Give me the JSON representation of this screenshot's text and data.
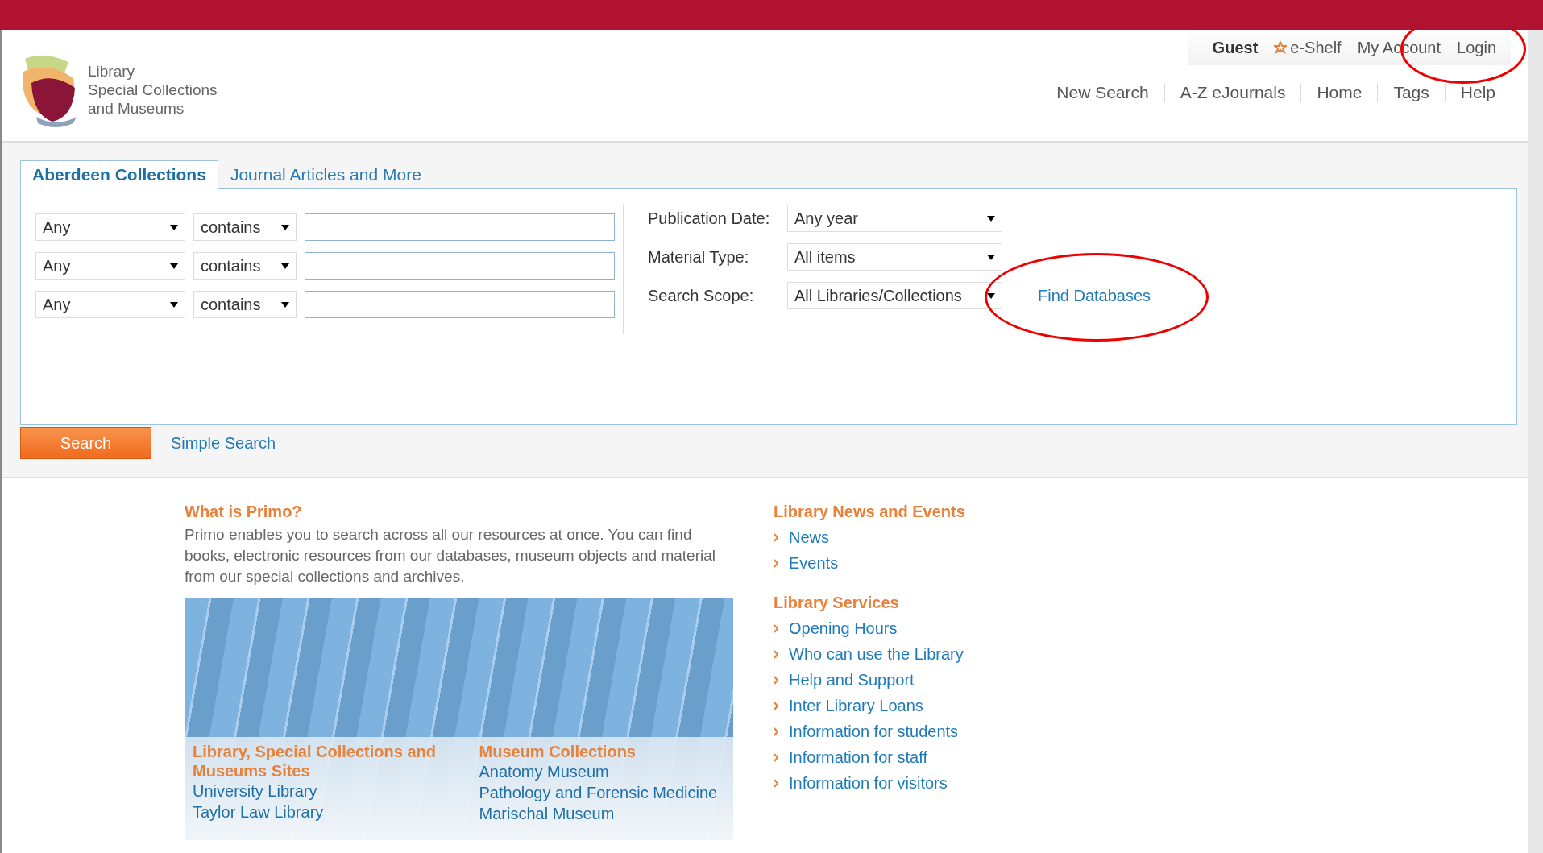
{
  "user_bar": {
    "user": "Guest",
    "links": [
      {
        "kind": "eshelf",
        "label": "e-Shelf"
      },
      {
        "kind": "plain",
        "label": "My Account"
      },
      {
        "kind": "plain",
        "label": "Login",
        "circled": true
      }
    ]
  },
  "logo": {
    "lines": [
      "Library",
      "Special Collections",
      "and Museums"
    ]
  },
  "nav": [
    "New Search",
    "A-Z eJournals",
    "Home",
    "Tags",
    "Help"
  ],
  "tabs": [
    {
      "label": "Aberdeen Collections",
      "selected": true
    },
    {
      "label": "Journal Articles and More",
      "selected": false
    }
  ],
  "query_rows": [
    {
      "field": "Any",
      "operator": "contains"
    },
    {
      "field": "Any",
      "operator": "contains"
    },
    {
      "field": "Any",
      "operator": "contains"
    }
  ],
  "filters": [
    {
      "label": "Publication Date:",
      "value": "Any year"
    },
    {
      "label": "Material Type:",
      "value": "All items"
    },
    {
      "label": "Search Scope:",
      "value": "All Libraries/Collections"
    }
  ],
  "find_databases": {
    "label": "Find Databases",
    "circled": true
  },
  "search_button": "Search",
  "simple_search": "Simple Search",
  "intro": {
    "title": "What is Primo?",
    "text": "Primo enables you to search across all our resources at once. You can find books, electronic resources from our databases, museum objects and material from our special collections and archives."
  },
  "photo_columns": [
    {
      "title": "Library, Special Collections and Museums Sites",
      "links": [
        "University Library",
        "Taylor Law Library"
      ]
    },
    {
      "title": "Museum Collections",
      "links": [
        "Anatomy Museum",
        "Pathology and Forensic Medicine",
        "Marischal Museum"
      ]
    }
  ],
  "sections": [
    {
      "title": "Library News and Events",
      "links": [
        "News",
        "Events"
      ]
    },
    {
      "title": "Library Services",
      "links": [
        "Opening Hours",
        "Who can use the Library",
        "Help and Support",
        "Inter Library Loans",
        "Information for students",
        "Information for staff",
        "Information for visitors"
      ]
    }
  ]
}
